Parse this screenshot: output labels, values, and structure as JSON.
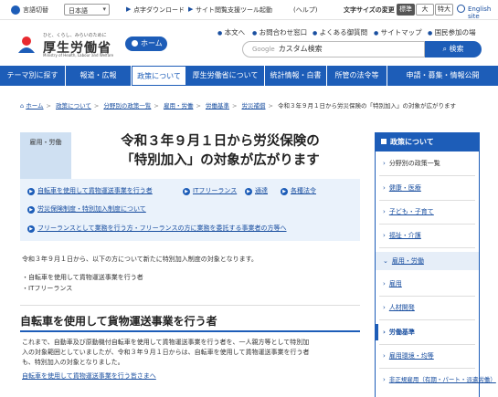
{
  "util": {
    "lang_label": "言語切替",
    "lang_value": "日本語",
    "links": [
      "点字ダウンロード",
      "サイト閲覧支援ツール起動",
      "(ヘルプ)"
    ],
    "size_label": "文字サイズの変更",
    "sizes": [
      "標準",
      "大",
      "特大"
    ],
    "english": "English site"
  },
  "header": {
    "logo_tag": "ひと、くらし、みらいのために",
    "logo_name": "厚生労働省",
    "logo_en": "Ministry of Health, Labour and Welfare",
    "home": "ホーム",
    "links": [
      "本文へ",
      "お問合わせ窓口",
      "よくある御質問",
      "サイトマップ",
      "国民参加の場"
    ],
    "search_google": "Google",
    "search_placeholder": "カスタム検索",
    "search_button": "検索"
  },
  "nav": [
    "テーマ別に探す",
    "報道・広報",
    "政策について",
    "厚生労働省について",
    "統計情報・白書",
    "所管の法令等",
    "申請・募集・情報公開"
  ],
  "breadcrumb": [
    "ホーム",
    "政策について",
    "分野別の政策一覧",
    "雇用・労働",
    "労働基準",
    "労災補償"
  ],
  "breadcrumb_current": "令和３年９月１日から労災保険の「特別加入」の対象が広がります",
  "category_tag": "雇用・労働",
  "title_line1": "令和３年９月１日から労災保険の",
  "title_line2": "「特別加入」の対象が広がります",
  "toc": [
    "自転車を使用して貨物運送事業を行う者",
    "ITフリーランス",
    "通達",
    "各種法令",
    "労災保険制度・特別加入制度について",
    "フリーランスとして業務を行う方・フリーランスの方に業務を委託する事業者の方等へ"
  ],
  "intro": "令和３年９月１日から、以下の方について新たに特別加入制度の対象となります。",
  "bullets": [
    "自転車を使用して貨物運送事業を行う者",
    "ITフリーランス"
  ],
  "section_heading": "自転車を使用して貨物運送事業を行う者",
  "paragraph": [
    "これまで、自動車及び原動機付自転車を使用して貨物運送事業を行う者を、一人親方等として特別加",
    "入の対象範囲としていましたが、令和３年９月１日からは、自転車を使用して貨物運送事業を行う者",
    "も、特別加入の対象となりました。"
  ],
  "more_link": "自転車を使用して貨物運送事業を行う皆さまへ",
  "sidebar": {
    "heading": "政策について",
    "items": [
      "分野別の政策一覧",
      "健康・医療",
      "子ども・子育て",
      "福祉・介護",
      "雇用・労働",
      "雇用",
      "人材開発",
      "労働基準",
      "雇用環境・均等",
      "非正規雇用（有期・パート・派遣労働）"
    ]
  },
  "colors": {
    "brand": "#1d5db8",
    "toc_bg": "#eaf2fb",
    "tag_bg": "#cfe0f2"
  }
}
